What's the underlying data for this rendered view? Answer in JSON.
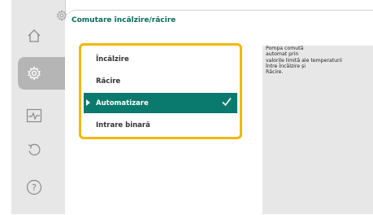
{
  "screen": {
    "title": "Comutare încălzire/răcire"
  },
  "sidebar": {
    "items": [
      {
        "icon": "home-icon",
        "active": false
      },
      {
        "icon": "gear-icon",
        "active": true
      },
      {
        "icon": "diagnostics-icon",
        "active": false
      },
      {
        "icon": "back-icon",
        "active": false
      },
      {
        "icon": "help-icon",
        "active": false
      }
    ]
  },
  "menu": {
    "items": [
      {
        "label": "Încălzire",
        "selected": false
      },
      {
        "label": "Răcire",
        "selected": false
      },
      {
        "label": "Automatizare",
        "selected": true
      },
      {
        "label": "Intrare binară",
        "selected": false
      }
    ]
  },
  "help": {
    "text": "Pompa comută\nautomat prin\nvalorile limită ale temperaturii\nîntre Încălzire și\nRăcire."
  },
  "colors": {
    "accent": "#0a7a6e",
    "focus": "#f2b705",
    "title": "#0a6b5d"
  }
}
